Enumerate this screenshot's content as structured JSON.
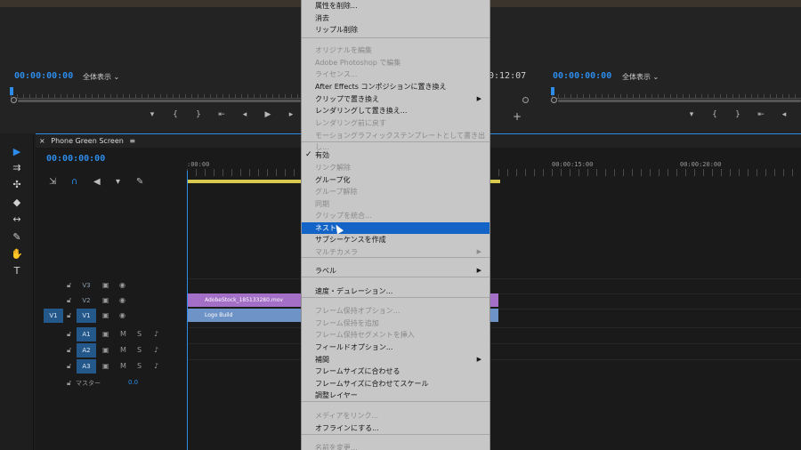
{
  "source_monitor": {
    "timecode": "00:00:00:00",
    "fit": "全体表示",
    "fit_chevron": "⌄",
    "transport": [
      "▾",
      "{",
      "}",
      "⇤",
      "◂",
      "▶",
      "▸"
    ]
  },
  "program_monitor": {
    "timecode": "00:00:00:00",
    "fit": "全体表示",
    "fit_chevron": "⌄",
    "duration": "0:12:07",
    "transport": [
      "▾",
      "{",
      "}",
      "⇤",
      "◂"
    ],
    "add_button": "+"
  },
  "tools": [
    "▶",
    "⇉",
    "✣",
    "◆",
    "↔",
    "✎",
    "✋",
    "T"
  ],
  "timeline": {
    "sequence_name": "Phone Green Screen",
    "tab_close": "×",
    "tab_menu": "≡",
    "timecode": "00:00:00:00",
    "ruler_labels": [
      ":00:00",
      "00:00:15:00",
      "00:00:20:00"
    ],
    "toolbar_icons": [
      "⇲",
      "∩",
      "◀",
      "▾",
      "✎"
    ],
    "tracks": {
      "v3": {
        "target": "V3"
      },
      "v2": {
        "target": "V2"
      },
      "v1": {
        "patch": "V1",
        "target": "V1"
      },
      "a1": {
        "target": "A1",
        "mute": "M",
        "solo": "S"
      },
      "a2": {
        "target": "A2",
        "mute": "M",
        "solo": "S"
      },
      "a3": {
        "target": "A3",
        "mute": "M",
        "solo": "S"
      }
    },
    "master": {
      "label": "マスター",
      "value": "0.0"
    },
    "clips": {
      "video": "AdobeStock_185133280.mov",
      "logo": "Logo Build"
    }
  },
  "context_menu": {
    "items": [
      {
        "label": "属性を削除...",
        "enabled": true
      },
      {
        "label": "消去",
        "enabled": true
      },
      {
        "label": "リップル削除",
        "enabled": true
      },
      {
        "label": "オリジナルを編集",
        "enabled": false
      },
      {
        "label": "Adobe Photoshop で編集",
        "enabled": false
      },
      {
        "label": "ライセンス...",
        "enabled": false
      },
      {
        "label": "After Effects コンポジションに置き換え",
        "enabled": true
      },
      {
        "label": "クリップで置き換え",
        "enabled": true,
        "submenu": "▶"
      },
      {
        "label": "レンダリングして置き換え...",
        "enabled": true
      },
      {
        "label": "レンダリング前に戻す",
        "enabled": false
      },
      {
        "label": "モーショングラフィックステンプレートとして書き出し...",
        "enabled": false
      },
      {
        "label": "有効",
        "enabled": true,
        "checked": "✓"
      },
      {
        "label": "リンク解除",
        "enabled": false
      },
      {
        "label": "グループ化",
        "enabled": true
      },
      {
        "label": "グループ解除",
        "enabled": false
      },
      {
        "label": "同期",
        "enabled": false
      },
      {
        "label": "クリップを統合...",
        "enabled": false
      },
      {
        "label": "ネスト...",
        "enabled": true,
        "highlighted": true
      },
      {
        "label": "サブシーケンスを作成",
        "enabled": true
      },
      {
        "label": "マルチカメラ",
        "enabled": false,
        "submenu": "▶"
      },
      {
        "label": "ラベル",
        "enabled": true,
        "submenu": "▶"
      },
      {
        "label": "速度・デュレーション...",
        "enabled": true
      },
      {
        "label": "フレーム保持オプション...",
        "enabled": false
      },
      {
        "label": "フレーム保持を追加",
        "enabled": false
      },
      {
        "label": "フレーム保持セグメントを挿入",
        "enabled": false
      },
      {
        "label": "フィールドオプション...",
        "enabled": true
      },
      {
        "label": "補間",
        "enabled": true,
        "submenu": "▶"
      },
      {
        "label": "フレームサイズに合わせる",
        "enabled": true
      },
      {
        "label": "フレームサイズに合わせてスケール",
        "enabled": true
      },
      {
        "label": "調整レイヤー",
        "enabled": true
      },
      {
        "label": "メディアをリンク...",
        "enabled": false
      },
      {
        "label": "オフラインにする...",
        "enabled": true
      },
      {
        "label": "名前を変更...",
        "enabled": false
      }
    ]
  },
  "colors": {
    "accent": "#2d8ceb",
    "menu_bg": "#c7c7c7",
    "menu_highlight": "#1464c8",
    "work_area": "#d6c94d",
    "clip_video": "#a46fc7",
    "clip_logo": "#6e93c7"
  }
}
